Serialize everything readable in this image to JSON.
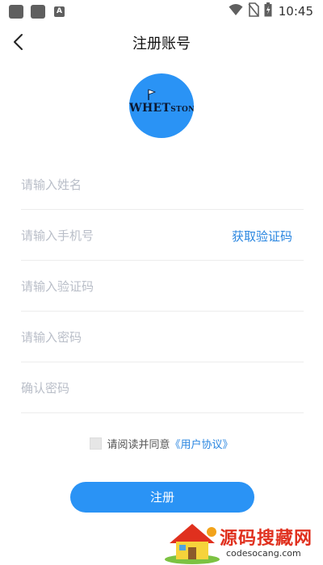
{
  "status_bar": {
    "time": "10:45",
    "left_icons": [
      "app-icon",
      "app-icon",
      "font-a-icon"
    ],
    "right_icons": [
      "wifi-icon",
      "no-sim-icon",
      "battery-icon"
    ],
    "a_glyph": "A"
  },
  "header": {
    "title": "注册账号",
    "back_icon": "chevron-left-icon"
  },
  "logo": {
    "brand_big": "WHET",
    "brand_small": "STONE",
    "color": "#2a93f5"
  },
  "form": {
    "name_placeholder": "请输入姓名",
    "phone_placeholder": "请输入手机号",
    "get_code_label": "获取验证码",
    "code_placeholder": "请输入验证码",
    "password_placeholder": "请输入密码",
    "confirm_placeholder": "确认密码"
  },
  "agreement": {
    "text": "请阅读并同意",
    "link": "《用户协议》",
    "checked": false
  },
  "register_button": {
    "label": "注册"
  },
  "watermark": {
    "title": "源码搜藏网",
    "url": "codesocang.com"
  },
  "colors": {
    "accent": "#2a93f5",
    "link": "#2a86e0",
    "placeholder": "#b9bec8"
  }
}
